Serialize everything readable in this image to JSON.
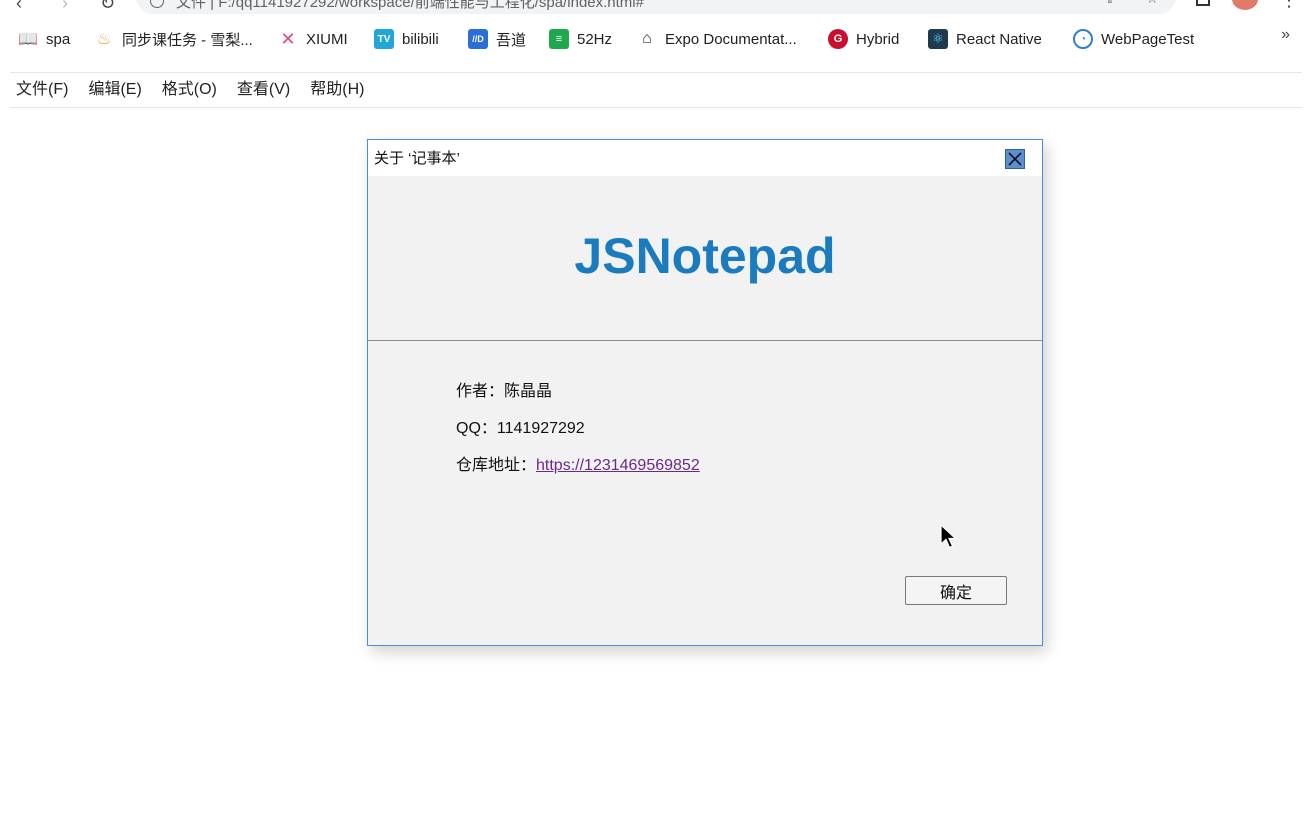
{
  "browser": {
    "address_text": "文件 | F:/qq1141927292/workspace/前端性能与工程化/spa/index.html#",
    "bookmarks": [
      {
        "label": "spa",
        "icon": "book-icon",
        "color": "#555555"
      },
      {
        "label": "同步课任务 - 雪梨...",
        "icon": "flame-icon",
        "color": "#f0a030"
      },
      {
        "label": "XIUMI",
        "icon": "xiumi-icon",
        "color": "#e44a7a"
      },
      {
        "label": "bilibili",
        "icon": "bilibili-icon",
        "color": "#22a6d8"
      },
      {
        "label": "吾道",
        "icon": "wudao-icon",
        "color": "#2a6fd8"
      },
      {
        "label": "52Hz",
        "icon": "sheet-icon",
        "color": "#1fa94f"
      },
      {
        "label": "Expo Documentat...",
        "icon": "expo-icon",
        "color": "#333333"
      },
      {
        "label": "Hybrid",
        "icon": "hybrid-icon",
        "color": "#c8102e"
      },
      {
        "label": "React Native",
        "icon": "react-icon",
        "color": "#1e3a4c"
      },
      {
        "label": "WebPageTest",
        "icon": "webpagetest-icon",
        "color": "#2d7fd3"
      }
    ],
    "more_label": "»"
  },
  "menubar": {
    "items": [
      "文件(F)",
      "编辑(E)",
      "格式(O)",
      "查看(V)",
      "帮助(H)"
    ]
  },
  "dialog": {
    "title": "关于  ‘记事本’",
    "brand": "JSNotepad",
    "author_label": "作者：",
    "author_value": "陈晶晶",
    "qq_label": "QQ：",
    "qq_value": "1141927292",
    "repo_label": "仓库地址：",
    "repo_value": "https://1231469569852",
    "ok_label": "确定",
    "accent_color": "#1a7bbf"
  }
}
